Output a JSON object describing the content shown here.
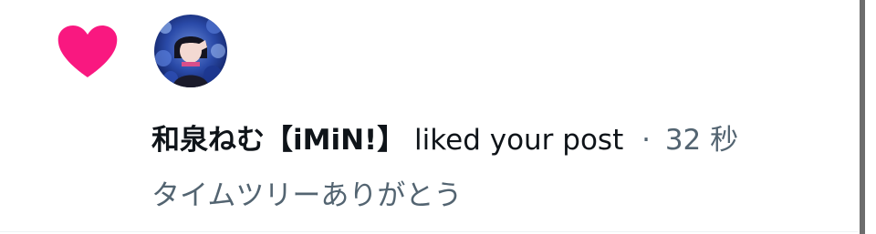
{
  "notification": {
    "icon": "heart-icon",
    "icon_color": "#f91880",
    "avatar_icon": "avatar-photo",
    "user_name": "和泉ねむ【iMiN!】",
    "action_text": "liked your post",
    "separator": "·",
    "timestamp": "32 秒",
    "post_text": "タイムツリーありがとう"
  },
  "colors": {
    "primary_text": "#0f1419",
    "secondary_text": "#536471",
    "background": "#ffffff",
    "scrollbar": "#6d6d6d"
  }
}
